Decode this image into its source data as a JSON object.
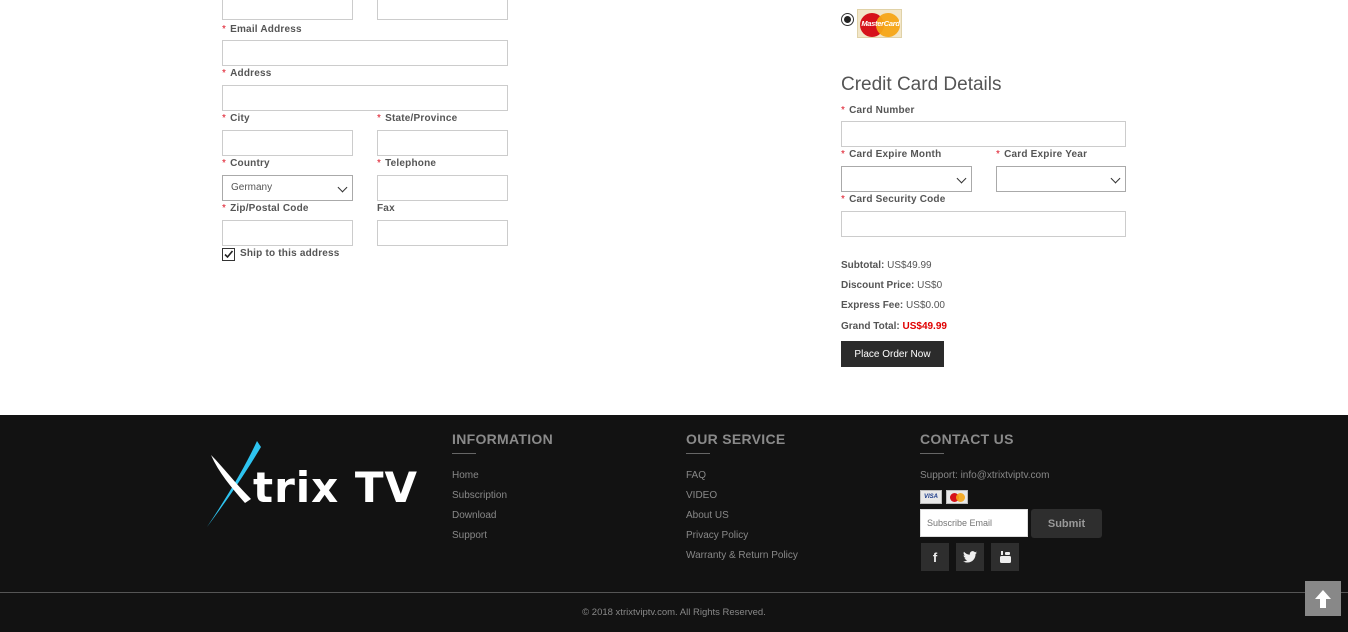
{
  "billing": {
    "email_label": "Email Address",
    "address_label": "Address",
    "city_label": "City",
    "state_label": "State/Province",
    "country_label": "Country",
    "country_value": "Germany",
    "telephone_label": "Telephone",
    "zip_label": "Zip/Postal Code",
    "fax_label": "Fax",
    "ship_label": "Ship to this address",
    "required_mark": "*"
  },
  "payment": {
    "card_logo_text": "MasterCard",
    "section_title": "Credit Card Details",
    "card_number_label": "Card Number",
    "expire_month_label": "Card Expire Month",
    "expire_year_label": "Card Expire Year",
    "security_code_label": "Card Security Code"
  },
  "totals": {
    "subtotal_label": "Subtotal:",
    "subtotal_value": "US$49.99",
    "discount_label": "Discount Price:",
    "discount_value": "US$0",
    "express_label": "Express Fee:",
    "express_value": "US$0.00",
    "grand_label": "Grand Total:",
    "grand_value": "US$49.99",
    "grand_color": "#e00000",
    "place_order": "Place Order Now"
  },
  "footer": {
    "logo_x": "X",
    "logo_rest": "trix TV",
    "information": {
      "title": "INFORMATION",
      "links": [
        "Home",
        "Subscription",
        "Download",
        "Support"
      ]
    },
    "service": {
      "title": "OUR SERVICE",
      "links": [
        "FAQ",
        "VIDEO",
        "About US",
        "Privacy Policy",
        "Warranty & Return Policy"
      ]
    },
    "contact": {
      "title": "CONTACT US",
      "support": "Support: info@xtrixtviptv.com",
      "visa": "VISA",
      "subscribe_placeholder": "Subscribe Email",
      "subscribe_button": "Submit",
      "social": [
        "facebook-icon",
        "twitter-icon",
        "youtube-icon"
      ]
    },
    "copyright": "© 2018 xtrixtviptv.com. All Rights Reserved."
  },
  "colors": {
    "footer_bg": "#121212",
    "button_bg": "#2b2b2b",
    "logo_cyan": "#2ec4f0"
  }
}
